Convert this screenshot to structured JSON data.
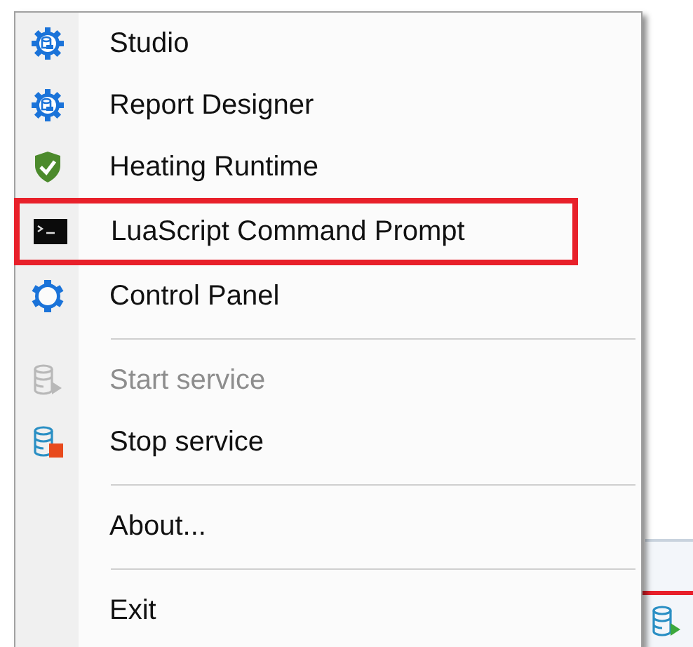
{
  "context_menu": {
    "items": [
      {
        "kind": "item",
        "label": "Studio",
        "disabled": false,
        "highlighted": false
      },
      {
        "kind": "item",
        "label": "Report Designer",
        "disabled": false,
        "highlighted": false
      },
      {
        "kind": "item",
        "label": "Heating Runtime",
        "disabled": false,
        "highlighted": false
      },
      {
        "kind": "item",
        "label": "LuaScript Command Prompt",
        "disabled": false,
        "highlighted": true
      },
      {
        "kind": "item",
        "label": "Control Panel",
        "disabled": false,
        "highlighted": false
      },
      {
        "kind": "separator"
      },
      {
        "kind": "item",
        "label": "Start service",
        "disabled": true,
        "highlighted": false
      },
      {
        "kind": "item",
        "label": "Stop service",
        "disabled": false,
        "highlighted": false
      },
      {
        "kind": "separator"
      },
      {
        "kind": "item",
        "label": "About...",
        "disabled": false,
        "highlighted": false
      },
      {
        "kind": "separator"
      },
      {
        "kind": "item",
        "label": "Exit",
        "disabled": false,
        "highlighted": false
      }
    ]
  },
  "tray": {
    "highlighted": true
  }
}
